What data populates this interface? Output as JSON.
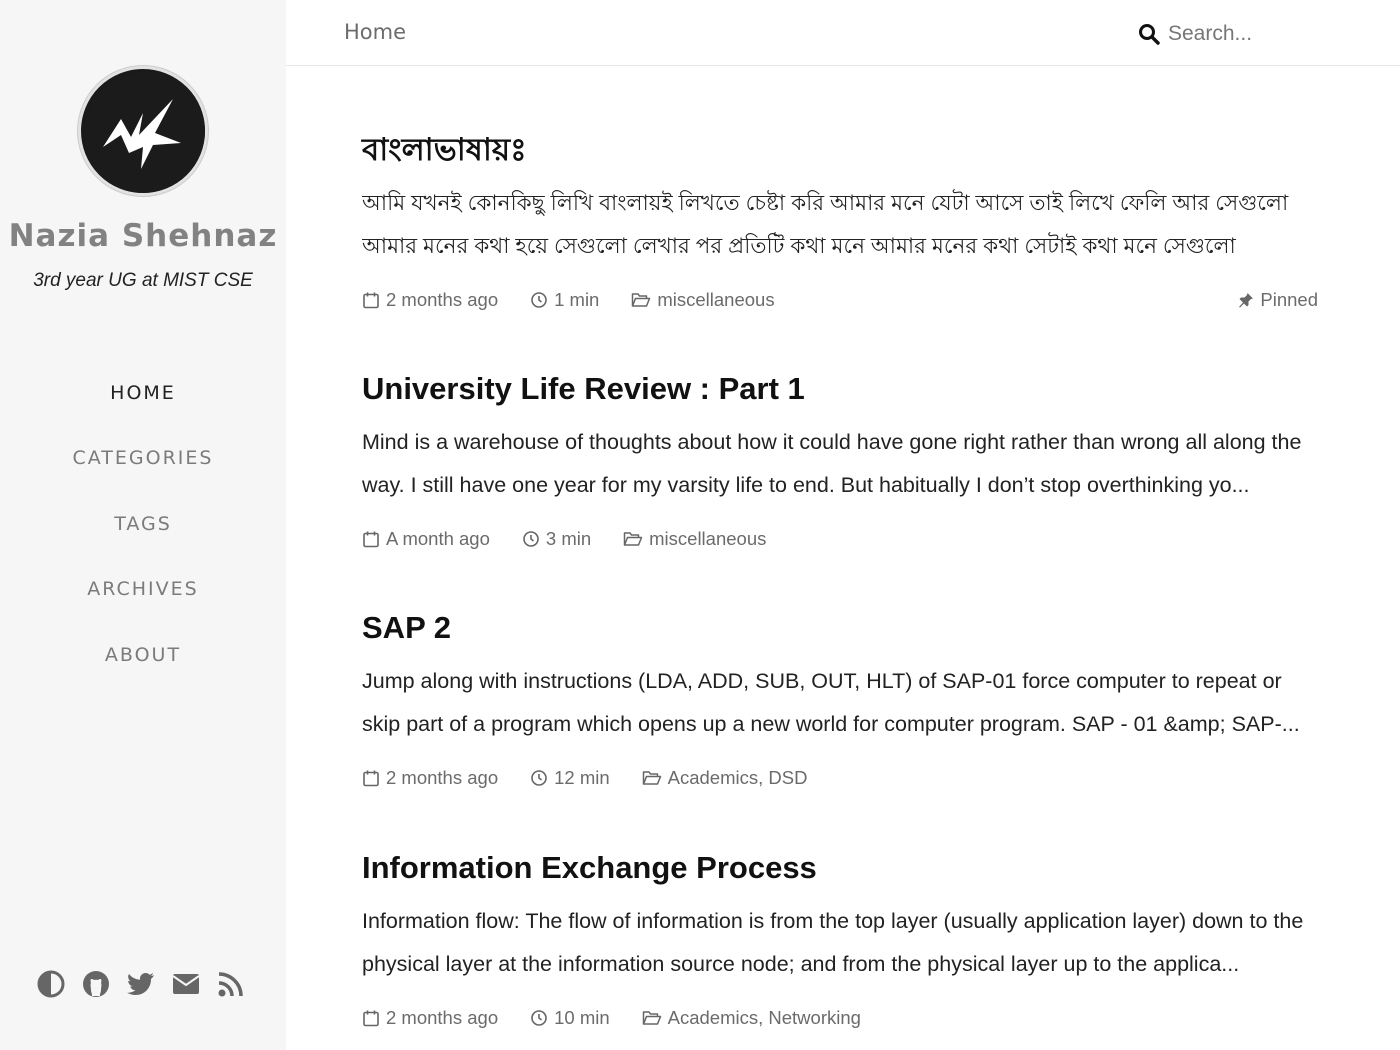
{
  "sidebar": {
    "site_title": "Nazia Shehnaz",
    "site_subtitle": "3rd year UG at MIST CSE",
    "nav": [
      {
        "label": "HOME",
        "active": true
      },
      {
        "label": "CATEGORIES",
        "active": false
      },
      {
        "label": "TAGS",
        "active": false
      },
      {
        "label": "ARCHIVES",
        "active": false
      },
      {
        "label": "ABOUT",
        "active": false
      }
    ],
    "bottom_icons": [
      "theme-toggle-icon",
      "github-icon",
      "twitter-icon",
      "email-icon",
      "rss-icon"
    ]
  },
  "topbar": {
    "breadcrumb": "Home",
    "search_placeholder": "Search..."
  },
  "posts": [
    {
      "title": "বাংলাভাষায়ঃ",
      "excerpt": "আমি যখনই কোনকিছু লিখি বাংলায়ই লিখতে চেষ্টা করি আমার মনে যেটা আসে তাই লিখে ফেলি আর সেগুলো আমার মনের কথা হয়ে সেগুলো লেখার পর প্রতিটি কথা মনে আমার মনের কথা সেটাই কথা মনে সেগুলো প্রকাশিতকরণের আমি মনের ...",
      "date": "2 months ago",
      "read_time": "1 min",
      "categories": "miscellaneous",
      "pinned": "Pinned"
    },
    {
      "title": "University Life Review : Part 1",
      "excerpt": "Mind is a warehouse of thoughts about how it could have gone right rather than wrong all along the way. I still have one year for my varsity life to end. But habitually I don’t stop overthinking yo...",
      "date": "A month ago",
      "read_time": "3 min",
      "categories": "miscellaneous"
    },
    {
      "title": "SAP 2",
      "excerpt": "Jump along with instructions (LDA, ADD, SUB, OUT, HLT) of SAP-01 force computer to repeat or skip part of a program which opens up a new world for computer program. SAP - 01 &amp; SAP-...",
      "date": "2 months ago",
      "read_time": "12 min",
      "categories": "Academics, DSD"
    },
    {
      "title": "Information Exchange Process",
      "excerpt": "Information flow: The flow of information is from the top layer (usually application layer) down to the physical layer at the information source node; and from the physical layer up to the applica...",
      "date": "2 months ago",
      "read_time": "10 min",
      "categories": "Academics, Networking"
    }
  ],
  "colors": {
    "sidebar_bg": "#f6f6f6",
    "title_gray": "#828282",
    "meta_gray": "#6b6b6b",
    "text_dark": "#222222"
  }
}
